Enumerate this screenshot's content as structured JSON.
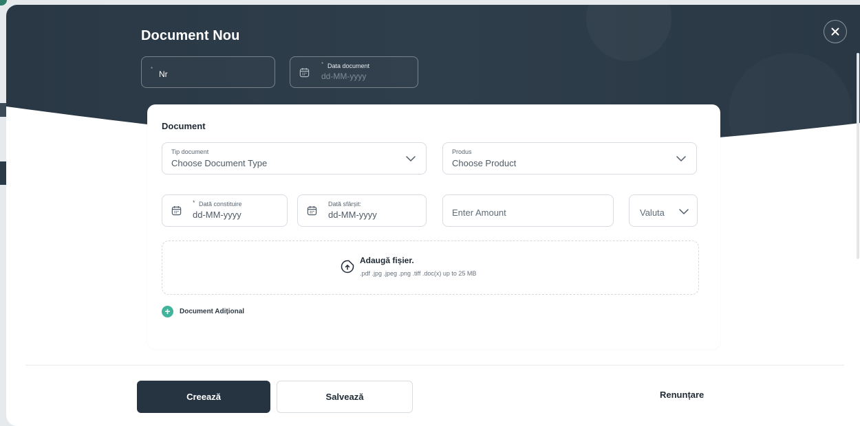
{
  "colors": {
    "hero": "#2b3a47",
    "accent_green": "#41b59b",
    "primary_button": "#263442"
  },
  "modal": {
    "title": "Document Nou",
    "close_icon": "close-icon",
    "header_fields": {
      "nr": {
        "label": "Nr",
        "required_mark": "*"
      },
      "data_document": {
        "label": "Data document",
        "placeholder": "dd-MM-yyyy",
        "required_mark": "*",
        "icon": "calendar-icon"
      }
    }
  },
  "document": {
    "section_title": "Document",
    "tip_document": {
      "label": "Tip document",
      "value": "Choose Document Type",
      "icon": "chevron-down-icon"
    },
    "produs": {
      "label": "Produs",
      "value": "Choose Product",
      "icon": "chevron-down-icon"
    },
    "data_constituire": {
      "label": "Dată constituire",
      "placeholder": "dd-MM-yyyy",
      "required_mark": "*",
      "icon": "calendar-icon"
    },
    "data_sfarsit": {
      "label": "Dată sfârșit:",
      "placeholder": "dd-MM-yyyy",
      "icon": "calendar-icon"
    },
    "amount": {
      "placeholder": "Enter Amount"
    },
    "valuta": {
      "value": "Valuta",
      "icon": "chevron-down-icon"
    },
    "upload": {
      "title": "Adaugă fișier.",
      "formats": ".pdf .jpg .jpeg .png .tiff .doc(x) up to 25 MB",
      "icon": "file-upload-icon"
    },
    "additional": {
      "label": "Document Adițional",
      "icon": "plus-circle-icon"
    }
  },
  "footer": {
    "create_label": "Creează",
    "save_label": "Salvează",
    "cancel_label": "Renunțare"
  }
}
